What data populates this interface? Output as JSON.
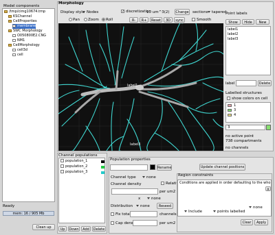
{
  "left_panel": {
    "title": "Model components",
    "tree": [
      {
        "label": "/tmp/cimg10674.tmp",
        "level": 0,
        "icon": "folder-icon"
      },
      {
        "label": "KSChannel",
        "level": 1,
        "icon": "folder-icon"
      },
      {
        "label": "CellProperties",
        "level": 1,
        "icon": "folder-icon"
      },
      {
        "label": "membrane",
        "level": 2,
        "icon": "document-icon",
        "selected": true
      },
      {
        "label": "SWC Morphology",
        "level": 1,
        "icon": "folder-icon"
      },
      {
        "label": "O050800E2.CNG",
        "level": 2,
        "icon": "document-icon"
      },
      {
        "label": "NM1",
        "level": 2,
        "icon": "document-icon"
      },
      {
        "label": "CellMorphology",
        "level": 1,
        "icon": "folder-icon"
      },
      {
        "label": "cell3d",
        "level": 2,
        "icon": "document-icon"
      },
      {
        "label": "cell",
        "level": 2,
        "icon": "document-icon"
      }
    ],
    "status": "Ready",
    "memory": "mem: 16 / 905 Mb",
    "cleanup_label": "Clean up"
  },
  "morphology": {
    "title": "Morphology",
    "display_style_label": "Display style",
    "display_style_value": "Nodes",
    "discretization_label": "discretization",
    "discretization_value": "10 um^3(2)",
    "change_label": "Change",
    "sections_label": "sections",
    "tapered_label": "tapered",
    "modes": [
      "Pan",
      "Zoom",
      "Roll"
    ],
    "toolbar_buttons": [
      "R-",
      "R+",
      "Reset",
      "3D",
      "sync"
    ],
    "smooth_label": "Smooth",
    "canvas_labels": [
      "label1",
      "label3"
    ],
    "point_labels_title": "Point labels",
    "show_all_label": "Show all",
    "hide_label": "Hide",
    "new_label": "New",
    "labels_list": [
      "label1",
      "label2",
      "label3"
    ],
    "label_field_prefix": "label",
    "delete_label": "Delete",
    "labelled_structures_title": "Labelled structures",
    "show_colors_label": "show colors on cell",
    "structure_items": [
      {
        "label": "1",
        "color": "#e8a0a8"
      },
      {
        "label": "3",
        "color": "#88e070"
      },
      {
        "label": "4",
        "color": "#f0e080"
      }
    ],
    "structure_field_value": "3",
    "no_active_point": "no active point",
    "compartments": "738 compartments",
    "no_channels": "no channels"
  },
  "channel_populations": {
    "title": "Channel populations",
    "items": [
      {
        "label": "population_1",
        "color": "#000000"
      },
      {
        "label": "population_2",
        "color": "#22cc44"
      },
      {
        "label": "population_3",
        "color": "#22cccc"
      }
    ],
    "buttons": [
      "Up",
      "Down",
      "Add",
      "Delete"
    ]
  },
  "population_properties": {
    "title": "Population properties",
    "rename_label": "Rename",
    "update_label": "Update channel positions",
    "channel_type_label": "Channel type",
    "channel_type_value": "none",
    "channel_density_label": "Channel density",
    "relative_label": "Relative",
    "per_um2": "per um2",
    "x_label": "x",
    "x_value": "none",
    "distribution_label": "Distribution",
    "distribution_value": "none",
    "reseed_label": "Reseed",
    "fix_total_label": "Fix total",
    "channels_label": "channels",
    "cap_density_label": "Cap density",
    "cap_per_um2": "per um2"
  },
  "region_constraints": {
    "title": "Region constraints",
    "message": "Conditions are applied in order defaulting to the who",
    "close_label": "X",
    "include_value": "Include",
    "points_labelled_value": "points labelled",
    "none_value": "none",
    "clear_label": "Clear",
    "apply_label": "Apply"
  }
}
